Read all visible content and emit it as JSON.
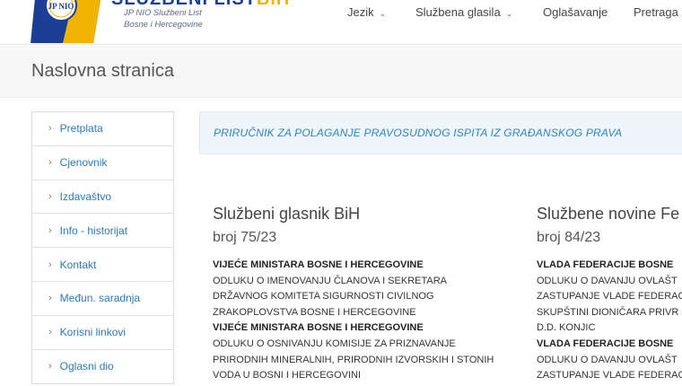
{
  "header": {
    "logo_badge": "JP NIO",
    "logo_wordmark_main": "SLUŽBENI LIST",
    "logo_wordmark_accent": "BiH",
    "logo_sub_line1": "JP NIO Službeni List",
    "logo_sub_line2": "Bosne i Hercegovine",
    "nav": [
      {
        "label": "Jezik",
        "has_dropdown": true
      },
      {
        "label": "Službena glasila",
        "has_dropdown": true
      },
      {
        "label": "Oglašavanje",
        "has_dropdown": false
      },
      {
        "label": "Pretraga",
        "has_dropdown": false
      }
    ]
  },
  "page_title": "Naslovna stranica",
  "sidebar": {
    "items": [
      {
        "label": "Pretplata"
      },
      {
        "label": "Cjenovnik"
      },
      {
        "label": "Izdavaštvo"
      },
      {
        "label": "Info - historijat"
      },
      {
        "label": "Kontakt"
      },
      {
        "label": "Međun. saradnja"
      },
      {
        "label": "Korisni linkovi"
      },
      {
        "label": "Oglasni dio"
      }
    ]
  },
  "banner": {
    "link_text": "PRIRUČNIK ZA POLAGANJE PRAVOSUDNOG ISPITA IZ GRAĐANSKOG PRAVA"
  },
  "gazettes": [
    {
      "title": "Službeni glasnik BiH",
      "issue": "broj 75/23",
      "lines": [
        {
          "kind": "org",
          "text": "VIJEĆE MINISTARA BOSNE I HERCEGOVINE"
        },
        {
          "kind": "doc",
          "text": "ODLUKU O IMENOVANJU ČLANOVA I SEKRETARA"
        },
        {
          "kind": "doc",
          "text": "DRŽAVNOG KOMITETA SIGURNOSTI CIVILNOG"
        },
        {
          "kind": "doc",
          "text": "ZRAKOPLOVSTVA BOSNE I HERCEGOVINE"
        },
        {
          "kind": "org",
          "text": "VIJEĆE MINISTARA BOSNE I HERCEGOVINE"
        },
        {
          "kind": "doc",
          "text": "ODLUKU O OSNIVANJU KOMISIJE ZA PRIZNAVANJE"
        },
        {
          "kind": "doc",
          "text": "PRIRODNIH MINERALNIH, PRIRODNIH IZVORSKIH I STONIH"
        },
        {
          "kind": "doc",
          "text": "VODA U BOSNI I HERCEGOVINI"
        }
      ]
    },
    {
      "title": "Službene novine Fe",
      "issue": "broj 84/23",
      "lines": [
        {
          "kind": "org",
          "text": "VLADA FEDERACIJE BOSNE"
        },
        {
          "kind": "doc",
          "text": "ODLUKU O DAVANJU OVLAŠT"
        },
        {
          "kind": "doc",
          "text": "ZASTUPANJE VLADE FEDERAC"
        },
        {
          "kind": "doc",
          "text": "SKUPŠTINI DIONIČARA PRIVR"
        },
        {
          "kind": "doc",
          "text": "D.D. KONJIC"
        },
        {
          "kind": "org",
          "text": "VLADA FEDERACIJE BOSNE"
        },
        {
          "kind": "doc",
          "text": "ODLUKU O DAVANJU OVLAŠT"
        },
        {
          "kind": "doc",
          "text": "ZASTUPANJE VLADE FEDERAC"
        }
      ]
    }
  ],
  "colors": {
    "brand_blue": "#1b3f94",
    "brand_yellow": "#f0b400",
    "link_blue": "#2a7ab8",
    "banner_bg": "#eef5fb"
  }
}
